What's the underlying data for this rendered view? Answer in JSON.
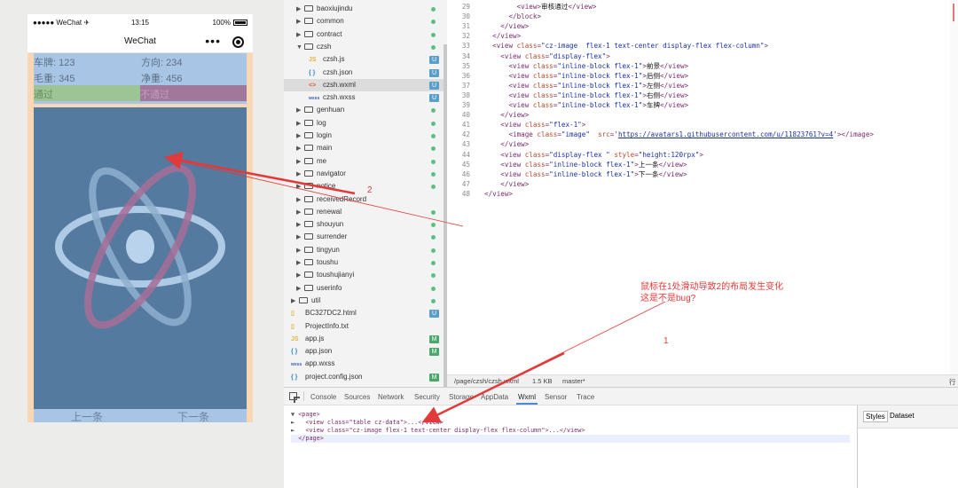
{
  "simulator": {
    "status_left": "●●●●● WeChat ✈",
    "status_time": "13:15",
    "status_battery": "100%",
    "nav_title": "WeChat",
    "nav_more": "•••",
    "table": {
      "plate_label": "车牌: 123",
      "direction_label": "方向: 234",
      "gross_label": "毛重: 345",
      "net_label": "净重: 456",
      "pass_label": "通过",
      "reject_label": "不通过"
    },
    "prev_button": "上一条",
    "next_button": "下一条"
  },
  "file_tree": {
    "items": [
      {
        "name": "baoxiujindu",
        "type": "folder",
        "indicator": "dot"
      },
      {
        "name": "common",
        "type": "folder",
        "indicator": "dot"
      },
      {
        "name": "contract",
        "type": "folder",
        "indicator": "dot"
      },
      {
        "name": "czsh",
        "type": "folder",
        "expanded": true,
        "indicator": "dot"
      },
      {
        "name": "czsh.js",
        "type": "js",
        "indicator": "U"
      },
      {
        "name": "czsh.json",
        "type": "json",
        "indicator": "U"
      },
      {
        "name": "czsh.wxml",
        "type": "wxml",
        "indicator": "U",
        "selected": true
      },
      {
        "name": "czsh.wxss",
        "type": "wxss",
        "indicator": "U"
      },
      {
        "name": "genhuan",
        "type": "folder",
        "indicator": "dot"
      },
      {
        "name": "log",
        "type": "folder",
        "indicator": "dot"
      },
      {
        "name": "login",
        "type": "folder",
        "indicator": "dot"
      },
      {
        "name": "main",
        "type": "folder",
        "indicator": "dot"
      },
      {
        "name": "me",
        "type": "folder",
        "indicator": "dot"
      },
      {
        "name": "navigator",
        "type": "folder",
        "indicator": "dot"
      },
      {
        "name": "notice",
        "type": "folder",
        "indicator": "dot"
      },
      {
        "name": "receivedRecord",
        "type": "folder",
        "indicator": "none"
      },
      {
        "name": "renewal",
        "type": "folder",
        "indicator": "dot"
      },
      {
        "name": "shouyun",
        "type": "folder",
        "indicator": "dot"
      },
      {
        "name": "surrender",
        "type": "folder",
        "indicator": "dot"
      },
      {
        "name": "tingyun",
        "type": "folder",
        "indicator": "dot"
      },
      {
        "name": "toushu",
        "type": "folder",
        "indicator": "dot"
      },
      {
        "name": "toushujianyi",
        "type": "folder",
        "indicator": "dot"
      },
      {
        "name": "userinfo",
        "type": "folder",
        "indicator": "dot"
      },
      {
        "name": "util",
        "type": "folder",
        "root": true,
        "indicator": "dot"
      },
      {
        "name": "BC327DC2.html",
        "type": "file",
        "root": true,
        "indicator": "U"
      },
      {
        "name": "ProjectInfo.txt",
        "type": "file",
        "root": true,
        "indicator": "none"
      },
      {
        "name": "app.js",
        "type": "js",
        "root": true,
        "indicator": "M"
      },
      {
        "name": "app.json",
        "type": "json",
        "root": true,
        "indicator": "M"
      },
      {
        "name": "app.wxss",
        "type": "wxss",
        "root": true,
        "indicator": "none"
      },
      {
        "name": "project.config.json",
        "type": "json",
        "root": true,
        "indicator": "M"
      }
    ]
  },
  "editor": {
    "lines": [
      {
        "n": "29",
        "indent": "        ",
        "parts": [
          [
            "tg",
            "<view>"
          ],
          [
            "tx",
            "审核通过"
          ],
          [
            "tg",
            "</view>"
          ]
        ]
      },
      {
        "n": "30",
        "indent": "      ",
        "parts": [
          [
            "tg",
            "</block>"
          ]
        ]
      },
      {
        "n": "31",
        "indent": "    ",
        "parts": [
          [
            "tg",
            "</view>"
          ]
        ]
      },
      {
        "n": "32",
        "indent": "  ",
        "parts": [
          [
            "tg",
            "</view>"
          ]
        ]
      },
      {
        "n": "33",
        "indent": "  ",
        "parts": [
          [
            "tg",
            "<view "
          ],
          [
            "at",
            "class"
          ],
          [
            "tg",
            "="
          ],
          [
            "sv",
            "\"cz-image  flex-1 text-center display-flex flex-column\""
          ],
          [
            "tg",
            ">"
          ]
        ]
      },
      {
        "n": "34",
        "indent": "    ",
        "parts": [
          [
            "tg",
            "<view "
          ],
          [
            "at",
            "class"
          ],
          [
            "tg",
            "="
          ],
          [
            "sv",
            "\"display-flex\""
          ],
          [
            "tg",
            ">"
          ]
        ]
      },
      {
        "n": "35",
        "indent": "      ",
        "parts": [
          [
            "tg",
            "<view "
          ],
          [
            "at",
            "class"
          ],
          [
            "tg",
            "="
          ],
          [
            "sv",
            "\"inline-block flex-1\""
          ],
          [
            "tg",
            ">"
          ],
          [
            "tx",
            "前景"
          ],
          [
            "tg",
            "</view>"
          ]
        ]
      },
      {
        "n": "36",
        "indent": "      ",
        "parts": [
          [
            "tg",
            "<view "
          ],
          [
            "at",
            "class"
          ],
          [
            "tg",
            "="
          ],
          [
            "sv",
            "\"inline-block flex-1\""
          ],
          [
            "tg",
            ">"
          ],
          [
            "tx",
            "后侧"
          ],
          [
            "tg",
            "</view>"
          ]
        ]
      },
      {
        "n": "37",
        "indent": "      ",
        "parts": [
          [
            "tg",
            "<view "
          ],
          [
            "at",
            "class"
          ],
          [
            "tg",
            "="
          ],
          [
            "sv",
            "\"inline-block flex-1\""
          ],
          [
            "tg",
            ">"
          ],
          [
            "tx",
            "左侧"
          ],
          [
            "tg",
            "</view>"
          ]
        ]
      },
      {
        "n": "38",
        "indent": "      ",
        "parts": [
          [
            "tg",
            "<view "
          ],
          [
            "at",
            "class"
          ],
          [
            "tg",
            "="
          ],
          [
            "sv",
            "\"inline-block flex-1\""
          ],
          [
            "tg",
            ">"
          ],
          [
            "tx",
            "右侧"
          ],
          [
            "tg",
            "</view>"
          ]
        ]
      },
      {
        "n": "39",
        "indent": "      ",
        "parts": [
          [
            "tg",
            "<view "
          ],
          [
            "at",
            "class"
          ],
          [
            "tg",
            "="
          ],
          [
            "sv",
            "\"inline-block flex-1\""
          ],
          [
            "tg",
            ">"
          ],
          [
            "tx",
            "车牌"
          ],
          [
            "tg",
            "</view>"
          ]
        ]
      },
      {
        "n": "40",
        "indent": "    ",
        "parts": [
          [
            "tg",
            "</view>"
          ]
        ]
      },
      {
        "n": "41",
        "indent": "    ",
        "parts": [
          [
            "tg",
            "<view "
          ],
          [
            "at",
            "class"
          ],
          [
            "tg",
            "="
          ],
          [
            "sv",
            "\"flex-1\""
          ],
          [
            "tg",
            ">"
          ]
        ]
      },
      {
        "n": "42",
        "indent": "      ",
        "parts": [
          [
            "tg",
            "<image "
          ],
          [
            "at",
            "class"
          ],
          [
            "tg",
            "="
          ],
          [
            "sv",
            "\"image\""
          ],
          [
            "tg",
            "  "
          ],
          [
            "at",
            "src"
          ],
          [
            "tg",
            "="
          ],
          [
            "sv",
            "'"
          ],
          [
            "url",
            "https://avatars1.githubusercontent.com/u/11823761?v=4"
          ],
          [
            "sv",
            "'"
          ],
          [
            "tg",
            "></image>"
          ]
        ]
      },
      {
        "n": "43",
        "indent": "    ",
        "parts": [
          [
            "tg",
            "</view>"
          ]
        ]
      },
      {
        "n": "44",
        "indent": "    ",
        "parts": [
          [
            "tg",
            "<view "
          ],
          [
            "at",
            "class"
          ],
          [
            "tg",
            "="
          ],
          [
            "sv",
            "\"display-flex \""
          ],
          [
            "tg",
            " "
          ],
          [
            "at",
            "style"
          ],
          [
            "tg",
            "="
          ],
          [
            "sv",
            "\"height:120rpx\""
          ],
          [
            "tg",
            ">"
          ]
        ]
      },
      {
        "n": "45",
        "indent": "    ",
        "parts": [
          [
            "tg",
            "<view "
          ],
          [
            "at",
            "class"
          ],
          [
            "tg",
            "="
          ],
          [
            "sv",
            "\"inline-block flex-1\""
          ],
          [
            "tg",
            ">"
          ],
          [
            "tx",
            "上一条"
          ],
          [
            "tg",
            "</view>"
          ]
        ]
      },
      {
        "n": "46",
        "indent": "    ",
        "parts": [
          [
            "tg",
            "<view "
          ],
          [
            "at",
            "class"
          ],
          [
            "tg",
            "="
          ],
          [
            "sv",
            "\"inline-block flex-1\""
          ],
          [
            "tg",
            ">"
          ],
          [
            "tx",
            "下一条"
          ],
          [
            "tg",
            "</view>"
          ]
        ]
      },
      {
        "n": "47",
        "indent": "    ",
        "parts": [
          [
            "tg",
            "</view>"
          ]
        ]
      },
      {
        "n": "48",
        "indent": "",
        "parts": [
          [
            "tg",
            "</view>"
          ]
        ]
      }
    ],
    "status_path": "/page/czsh/czsh.wxml",
    "status_size": "1.5 KB",
    "status_branch": "master*",
    "status_right": "行"
  },
  "devtools": {
    "tabs": [
      "Console",
      "Sources",
      "Network",
      "Security",
      "Storage",
      "AppData",
      "Wxml",
      "Sensor",
      "Trace"
    ],
    "active_tab": "Wxml",
    "dom_lines": [
      {
        "tri": "▼",
        "text": "<page>"
      },
      {
        "tri": "►",
        "text": "  <view class=\"table cz-data\">...</view>"
      },
      {
        "tri": "►",
        "text": "  <view class=\"cz-image flex-1 text-center display-flex flex-column\">...</view>"
      },
      {
        "tri": "",
        "text": "</page>"
      }
    ],
    "side_tabs": [
      "Styles",
      "Dataset"
    ]
  },
  "annotations": {
    "label_2": "2",
    "label_1": "1",
    "question_line1": "鼠标在1处滑动导致2的布局发生变化",
    "question_line2": "这是不是bug?",
    "color": "#e23a3a"
  },
  "colors": {
    "table_bg": "#a8c5e6",
    "pass_bg": "#9cc495",
    "reject_bg": "#a1789b",
    "image_bg": "#557aa0",
    "orange_bg": "#f9d7b4"
  }
}
